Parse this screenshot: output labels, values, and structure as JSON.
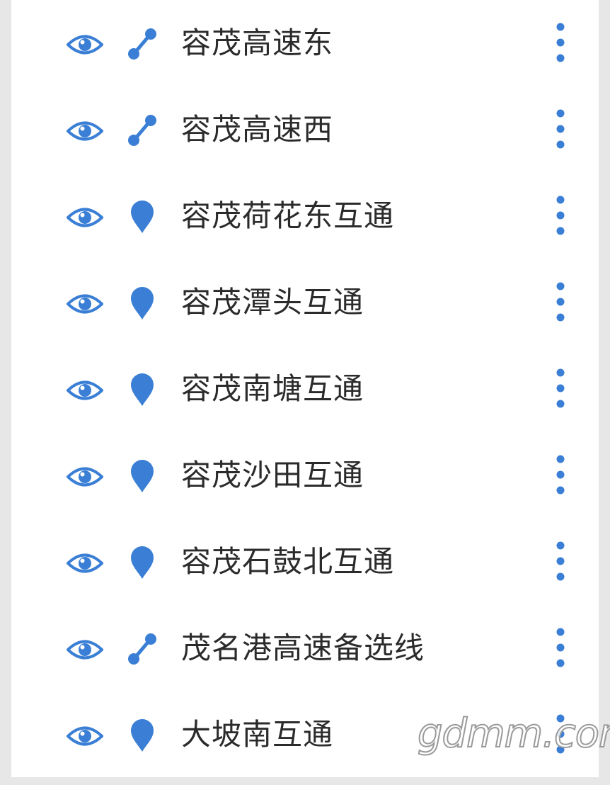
{
  "accent_color": "#3a7fd5",
  "layers": [
    {
      "label": "容茂高速东",
      "type": "line",
      "type_icon": "route-icon"
    },
    {
      "label": "容茂高速西",
      "type": "line",
      "type_icon": "route-icon"
    },
    {
      "label": "容茂荷花东互通",
      "type": "point",
      "type_icon": "map-pin-icon"
    },
    {
      "label": "容茂潭头互通",
      "type": "point",
      "type_icon": "map-pin-icon"
    },
    {
      "label": "容茂南塘互通",
      "type": "point",
      "type_icon": "map-pin-icon"
    },
    {
      "label": "容茂沙田互通",
      "type": "point",
      "type_icon": "map-pin-icon"
    },
    {
      "label": "容茂石鼓北互通",
      "type": "point",
      "type_icon": "map-pin-icon"
    },
    {
      "label": "茂名港高速备选线",
      "type": "line",
      "type_icon": "route-icon"
    },
    {
      "label": "大坡南互通",
      "type": "point",
      "type_icon": "map-pin-icon"
    }
  ],
  "watermark": "gdmm.com"
}
